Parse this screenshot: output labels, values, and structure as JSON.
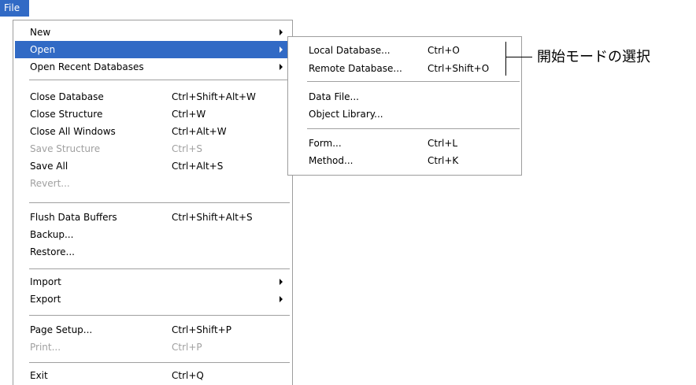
{
  "menubar": {
    "file_label": "File"
  },
  "file_menu": {
    "items": [
      {
        "label": "New",
        "shortcut": "",
        "submenu": true
      },
      {
        "label": "Open",
        "shortcut": "",
        "submenu": true,
        "highlighted": true
      },
      {
        "label": "Open Recent Databases",
        "shortcut": "",
        "submenu": true
      },
      {
        "label": "Close Database",
        "shortcut": "Ctrl+Shift+Alt+W"
      },
      {
        "label": "Close Structure",
        "shortcut": "Ctrl+W"
      },
      {
        "label": "Close All Windows",
        "shortcut": "Ctrl+Alt+W"
      },
      {
        "label": "Save Structure",
        "shortcut": "Ctrl+S",
        "disabled": true
      },
      {
        "label": "Save All",
        "shortcut": "Ctrl+Alt+S"
      },
      {
        "label": "Revert...",
        "shortcut": "",
        "disabled": true
      },
      {
        "label": "Flush Data Buffers",
        "shortcut": "Ctrl+Shift+Alt+S"
      },
      {
        "label": "Backup...",
        "shortcut": ""
      },
      {
        "label": "Restore...",
        "shortcut": ""
      },
      {
        "label": "Import",
        "shortcut": "",
        "submenu": true
      },
      {
        "label": "Export",
        "shortcut": "",
        "submenu": true
      },
      {
        "label": "Page Setup...",
        "shortcut": "Ctrl+Shift+P"
      },
      {
        "label": "Print...",
        "shortcut": "Ctrl+P",
        "disabled": true
      },
      {
        "label": "Exit",
        "shortcut": "Ctrl+Q"
      }
    ]
  },
  "open_submenu": {
    "items": [
      {
        "label": "Local Database...",
        "shortcut": "Ctrl+O"
      },
      {
        "label": "Remote Database...",
        "shortcut": "Ctrl+Shift+O"
      },
      {
        "label": "Data File...",
        "shortcut": ""
      },
      {
        "label": "Object Library...",
        "shortcut": ""
      },
      {
        "label": "Form...",
        "shortcut": "Ctrl+L"
      },
      {
        "label": "Method...",
        "shortcut": "Ctrl+K"
      }
    ]
  },
  "annotation": {
    "text": "開始モードの選択"
  },
  "colors": {
    "highlight": "#316ac5",
    "disabled": "#a0a0a0",
    "border": "#9d9d9d"
  }
}
